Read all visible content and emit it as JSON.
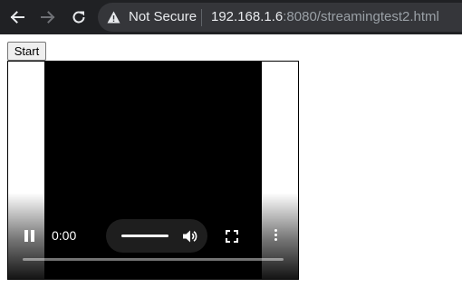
{
  "browser": {
    "security_label": "Not Secure",
    "url_host": "192.168.1.6",
    "url_rest": ":8080/streamingtest2.html",
    "nav_icons": [
      "back-arrow-icon",
      "forward-arrow-icon",
      "reload-icon",
      "warning-icon"
    ],
    "colors": {
      "toolbar": "#202124",
      "omnibox": "#35363a",
      "text_primary": "#e8eaed",
      "text_secondary": "#9aa0a6"
    }
  },
  "page": {
    "start_button_label": "Start"
  },
  "video": {
    "current_time": "0:00",
    "state": "playing",
    "progress": 0,
    "icons": [
      "pause-icon",
      "volume-icon",
      "fullscreen-icon",
      "more-options-icon"
    ]
  }
}
